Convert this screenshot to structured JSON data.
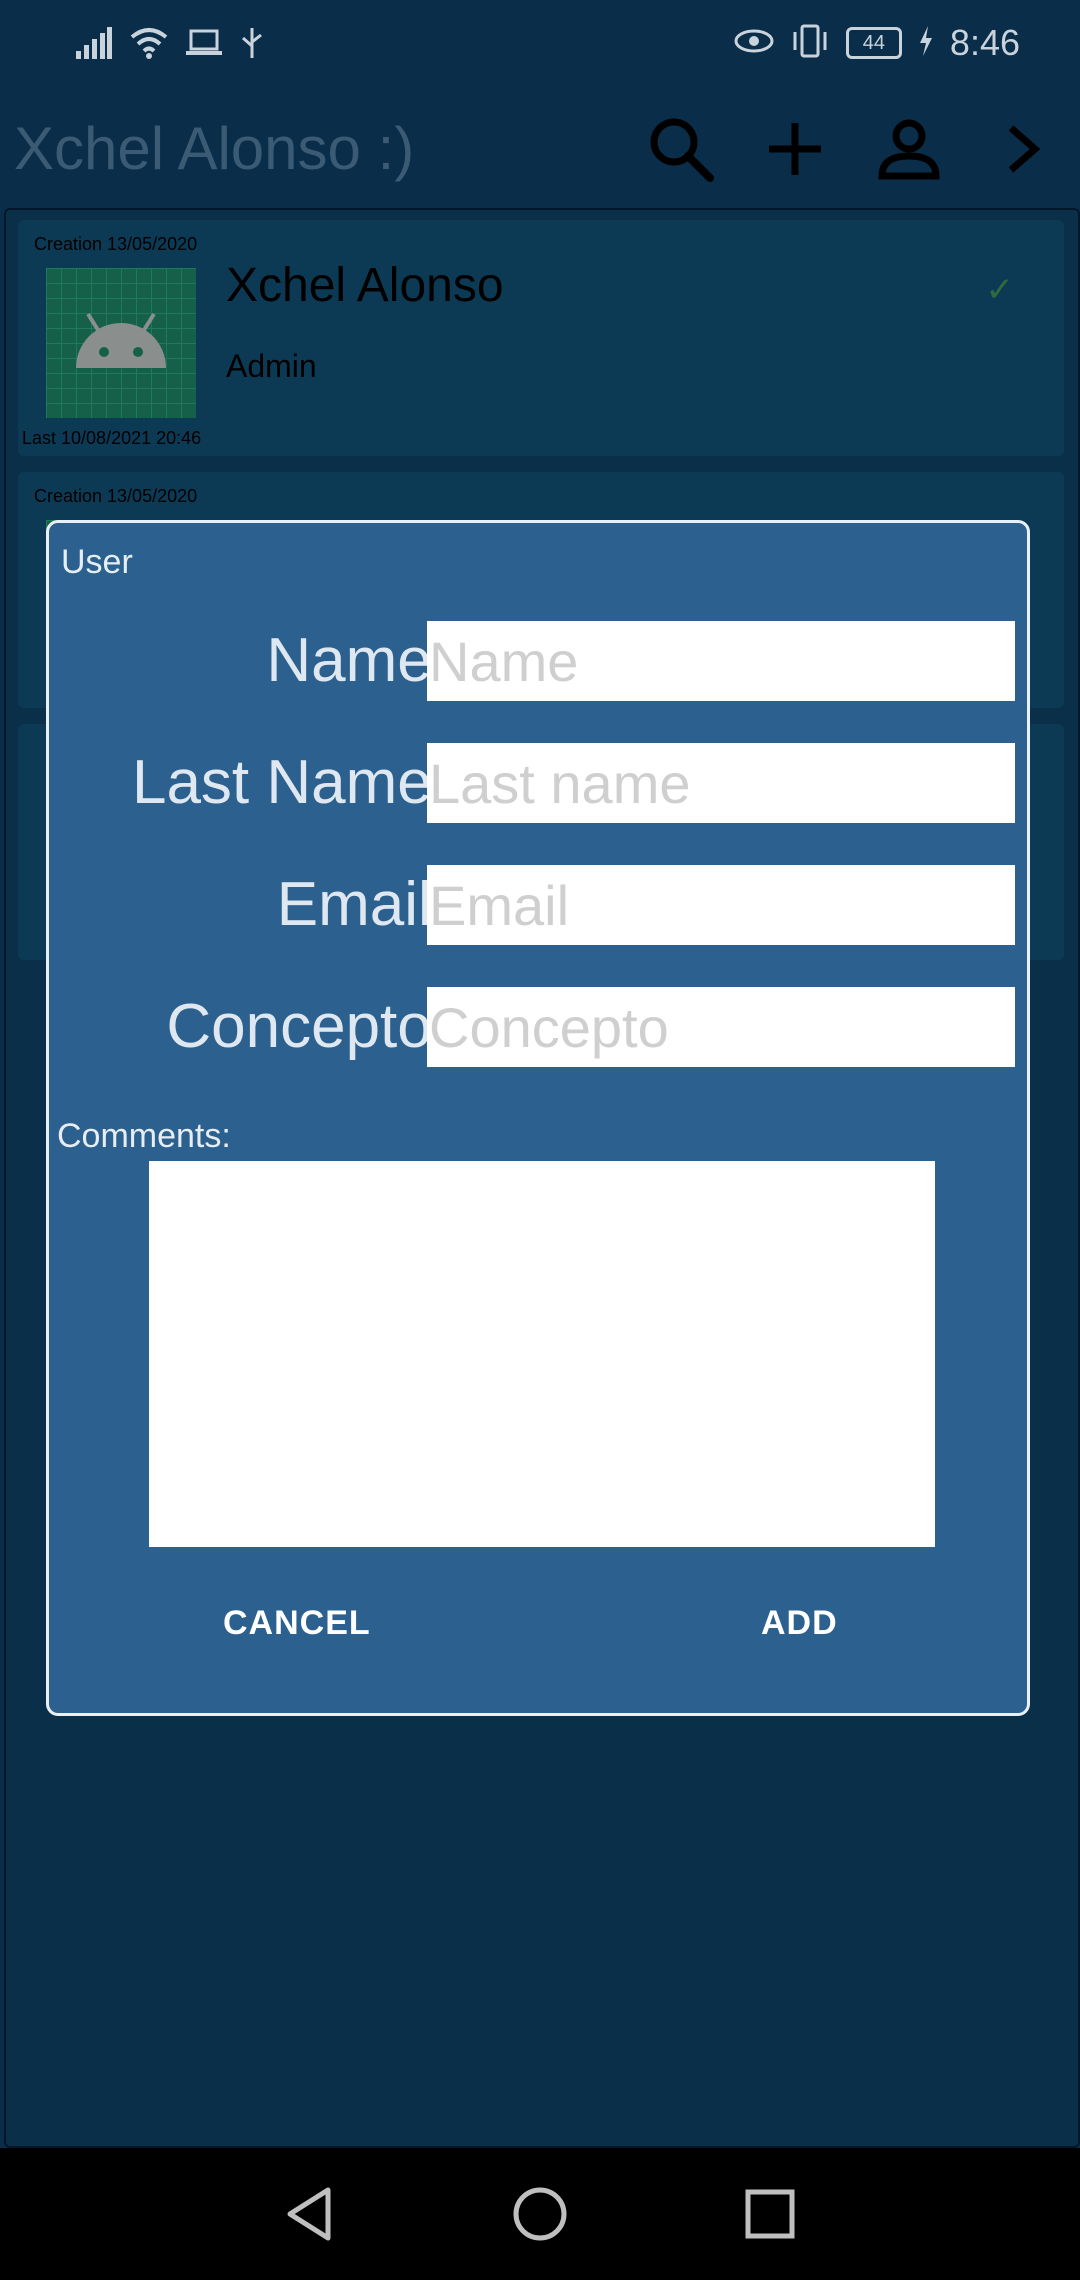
{
  "status_bar": {
    "time": "8:46",
    "battery": "44",
    "icons": [
      "signal-icon",
      "wifi-icon",
      "laptop-icon",
      "usb-icon",
      "eye-icon",
      "vibrate-icon",
      "battery-icon",
      "charging-icon"
    ]
  },
  "app_bar": {
    "title": "Xchel Alonso :)",
    "actions": [
      "search-icon",
      "add-icon",
      "person-icon",
      "chevron-right-icon"
    ]
  },
  "list": {
    "cards": [
      {
        "created": "Creation 13/05/2020",
        "name": "Xchel Alonso",
        "role": "Admin",
        "last": "Last 10/08/2021 20:46",
        "check": "✓"
      },
      {
        "created": "Creation 13/05/2020"
      }
    ]
  },
  "dialog": {
    "title": "User",
    "fields": [
      {
        "label": "Name:",
        "placeholder": "Name",
        "value": ""
      },
      {
        "label": "Last Name:",
        "placeholder": "Last name",
        "value": ""
      },
      {
        "label": "Email:",
        "placeholder": "Email",
        "value": ""
      },
      {
        "label": "Concepto:",
        "placeholder": "Concepto",
        "value": ""
      }
    ],
    "comments_label": "Comments:",
    "comments_value": "",
    "cancel_label": "CANCEL",
    "add_label": "ADD"
  },
  "nav_bar": {
    "icons": [
      "back-icon",
      "home-icon",
      "recents-icon"
    ]
  },
  "colors": {
    "background": "#0a2d49",
    "dialog": "#2c618f",
    "app_title": "#3b5a73"
  }
}
